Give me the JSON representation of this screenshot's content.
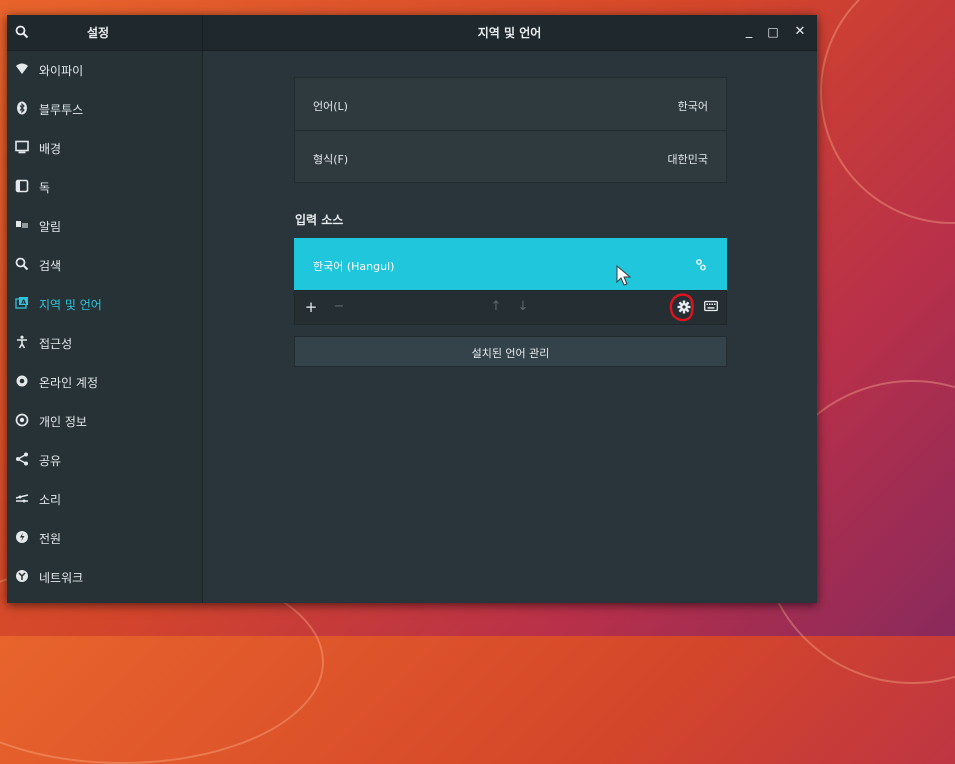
{
  "window": {
    "sidebar_title": "설정",
    "title": "지역 및 언어",
    "controls": [
      "_",
      "□",
      "✕"
    ]
  },
  "sidebar": {
    "items": [
      {
        "label": "와이파이",
        "icon": "wifi-icon"
      },
      {
        "label": "블루투스",
        "icon": "bluetooth-icon"
      },
      {
        "label": "배경",
        "icon": "background-icon"
      },
      {
        "label": "독",
        "icon": "dock-icon"
      },
      {
        "label": "알림",
        "icon": "notifications-icon"
      },
      {
        "label": "검색",
        "icon": "search-icon"
      },
      {
        "label": "지역 및 언어",
        "icon": "region-language-icon",
        "active": true
      },
      {
        "label": "접근성",
        "icon": "accessibility-icon"
      },
      {
        "label": "온라인 계정",
        "icon": "online-accounts-icon"
      },
      {
        "label": "개인 정보",
        "icon": "privacy-icon"
      },
      {
        "label": "공유",
        "icon": "share-icon"
      },
      {
        "label": "소리",
        "icon": "sound-icon"
      },
      {
        "label": "전원",
        "icon": "power-icon"
      },
      {
        "label": "네트워크",
        "icon": "network-icon"
      }
    ]
  },
  "main": {
    "language": {
      "label": "언어(L)",
      "value": "한국어"
    },
    "formats": {
      "label": "형식(F)",
      "value": "대한민국"
    },
    "input_sources": {
      "title": "입력 소스",
      "items": [
        {
          "label": "한국어 (Hangul)",
          "selected": true
        }
      ],
      "toolbar": {
        "add": "+",
        "remove": "−",
        "up": "↑",
        "down": "↓"
      }
    },
    "manage_button": "설치된 언어 관리"
  },
  "colors": {
    "accent": "#1fc6dc",
    "window_bg": "#29353a",
    "annotation": "#e0141e"
  }
}
